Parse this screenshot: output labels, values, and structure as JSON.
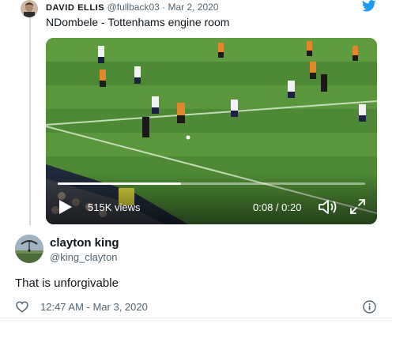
{
  "quoted_tweet": {
    "author_name": "DAVID ELLIS",
    "handle": "@fullback03",
    "separator": "·",
    "date": "Mar 2, 2020",
    "text": "NDombele - Tottenhams engine room",
    "video": {
      "views": "515K views",
      "time": "0:08 / 0:20",
      "progress": 0.4
    }
  },
  "reply_tweet": {
    "author_name": "clayton king",
    "handle": "@king_clayton",
    "text": "That is unforgivable",
    "timestamp": "12:47 AM - Mar 3, 2020"
  },
  "icons": {
    "brand": "twitter-bird-icon",
    "play": "play-icon",
    "volume": "volume-icon",
    "fullscreen": "fullscreen-icon",
    "like": "heart-icon",
    "info": "info-icon"
  },
  "colors": {
    "twitter_blue": "#1d9bf0",
    "secondary_text": "#536471",
    "primary_text": "#0f1419"
  }
}
